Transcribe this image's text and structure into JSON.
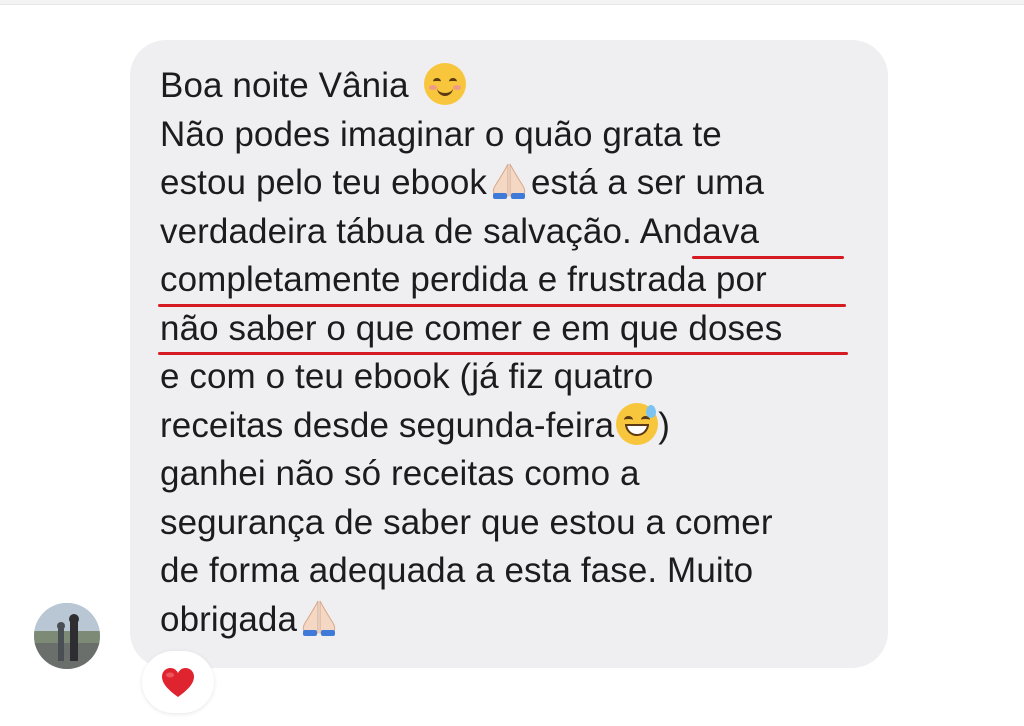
{
  "message": {
    "lines": [
      "Boa noite Vânia",
      "Não podes imaginar o quão grata te",
      "estou pelo teu ebook",
      "está a ser uma",
      "verdadeira tábua de salvação. ",
      "Andava",
      "completamente perdida e frustrada por",
      "não saber o que comer e em que doses",
      "e com o teu ebook (já fiz quatro",
      "receitas desde segunda-feira",
      ")",
      "ganhei não só receitas como a",
      "segurança de saber que estou a comer",
      "de forma adequada a esta fase. Muito",
      "obrigada"
    ],
    "emojis": {
      "greeting": "smiling-face-icon",
      "thanks": "praying-hands-icon",
      "sweat": "grinning-sweat-face-icon",
      "closing": "praying-hands-icon"
    },
    "highlight_color": "#d51a22"
  },
  "reaction": {
    "icon": "heart-icon",
    "color": "#e0242f"
  },
  "bubble_color": "#efeff1"
}
